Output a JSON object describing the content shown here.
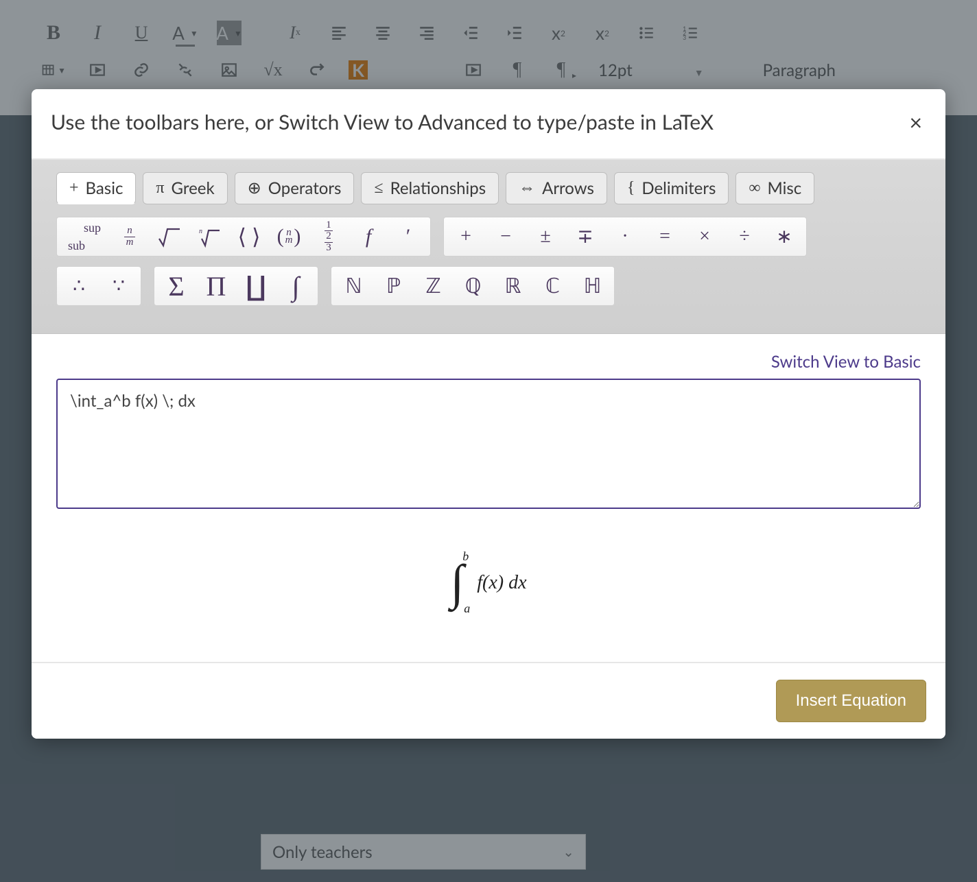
{
  "bg_toolbar": {
    "font_size": "12pt",
    "style_dropdown": "Paragraph",
    "only_teachers": "Only teachers"
  },
  "modal": {
    "title": "Use the toolbars here, or Switch View to Advanced to type/paste in LaTeX",
    "tabs": [
      {
        "prefix": "+",
        "label": "Basic"
      },
      {
        "prefix": "π",
        "label": "Greek"
      },
      {
        "prefix": "⊕",
        "label": "Operators"
      },
      {
        "prefix": "≤",
        "label": "Relationships"
      },
      {
        "prefix": "⇔",
        "label": "Arrows"
      },
      {
        "prefix": "{",
        "label": "Delimiters"
      },
      {
        "prefix": "∞",
        "label": "Misc"
      }
    ],
    "symbol_groups": {
      "row1": {
        "structures": [
          "subsup",
          "frac",
          "sqrt",
          "nthroot",
          "anglebrackets",
          "binom",
          "stackedfrac",
          "ffunc",
          "prime"
        ],
        "operators": [
          "+",
          "−",
          "±",
          "∓",
          "·",
          "=",
          "×",
          "÷",
          "∗"
        ]
      },
      "row2": {
        "dots": [
          "∴",
          "∵"
        ],
        "bigops": [
          "Σ",
          "Π",
          "∐",
          "∫"
        ],
        "sets": [
          "ℕ",
          "ℙ",
          "ℤ",
          "ℚ",
          "ℝ",
          "ℂ",
          "ℍ"
        ]
      }
    },
    "switch_link": "Switch View to Basic",
    "latex_input": "\\int_a^b f(x) \\; dx",
    "preview": {
      "lower": "a",
      "upper": "b",
      "expr": "f(x)  dx"
    },
    "insert_button": "Insert Equation"
  }
}
